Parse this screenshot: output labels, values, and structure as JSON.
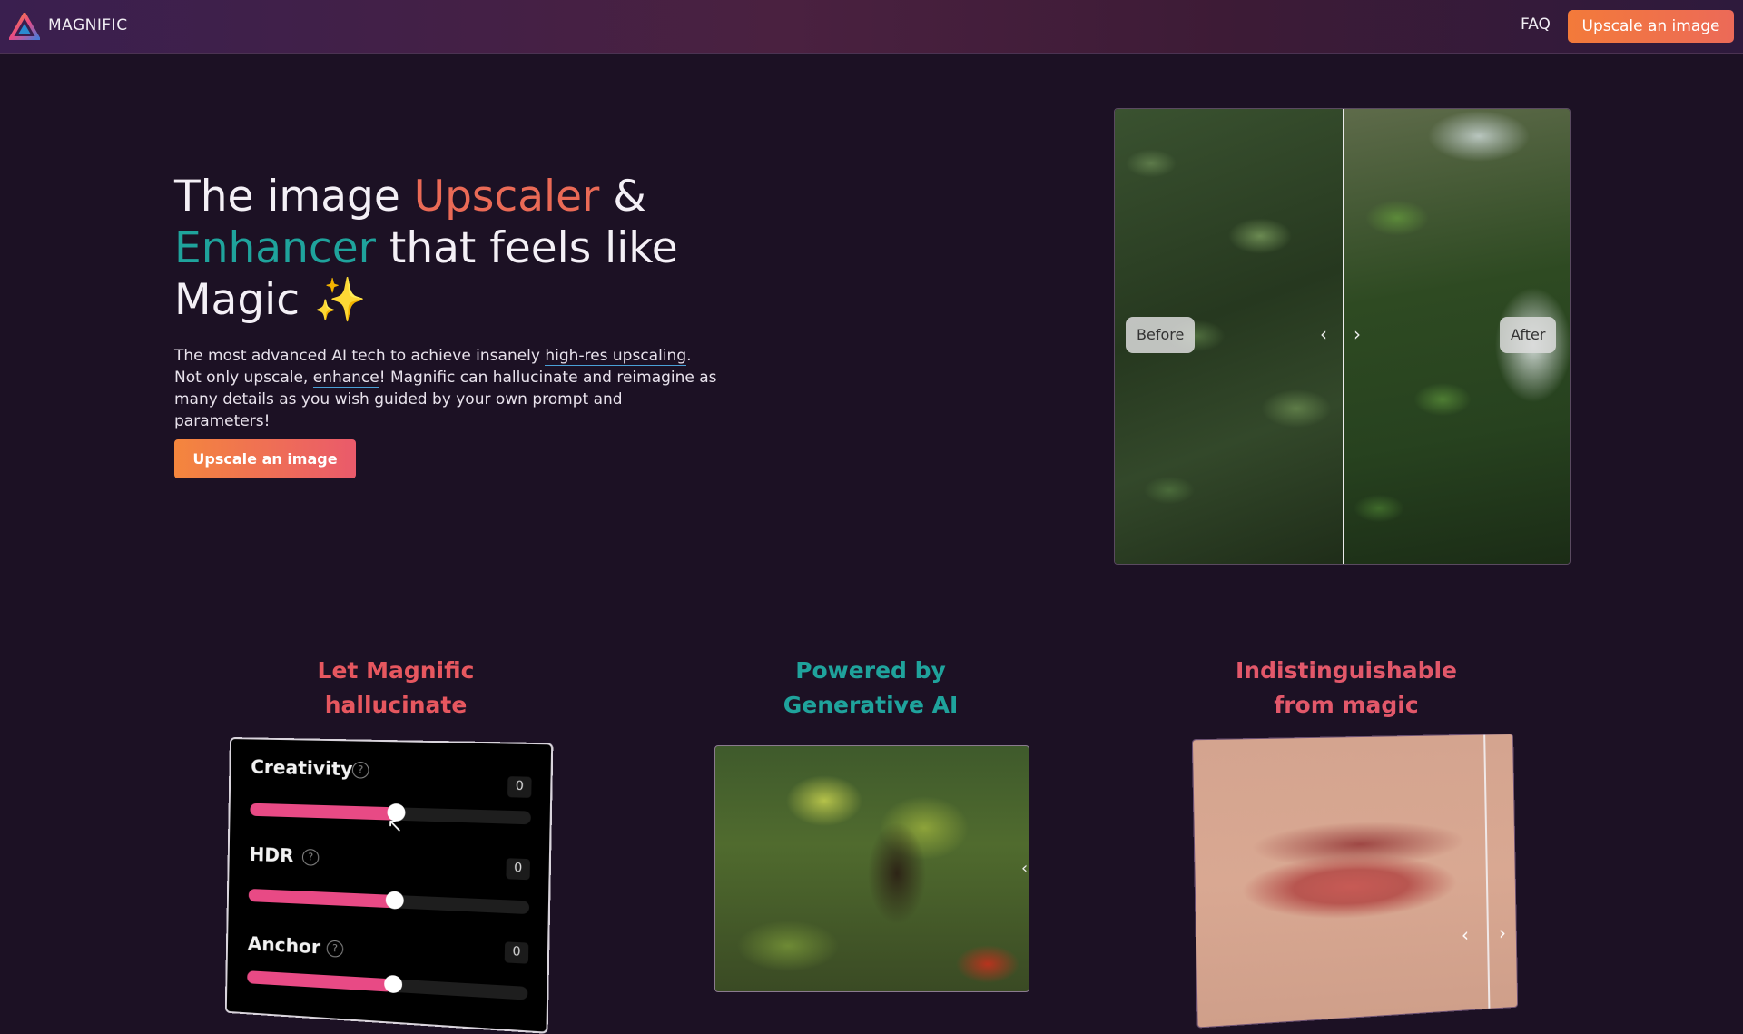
{
  "header": {
    "brand": "MAGNIFIC",
    "faq": "FAQ",
    "cta": "Upscale an image"
  },
  "hero": {
    "title_part1": "The image ",
    "title_upscaler": "Upscaler",
    "title_amp": " &",
    "title_enhancer": "Enhancer",
    "title_part2": " that feels like",
    "title_part3": "Magic ",
    "title_glyph": "✨",
    "desc_1": "The most advanced AI tech to achieve insanely ",
    "link_highres": "high-res upscaling",
    "desc_2": ". Not only upscale, ",
    "link_enhance": "enhance",
    "desc_3": "! Magnific can hallucinate and reimagine as many details as you wish guided by ",
    "link_prompt": "your own prompt",
    "desc_4": " and parameters!",
    "cta": "Upscale an image"
  },
  "compare": {
    "before_label": "Before",
    "after_label": "After",
    "prev_icon": "chevron-left-icon",
    "next_icon": "chevron-right-icon"
  },
  "features": [
    {
      "title_line1": "Let Magnific",
      "title_line2": "hallucinate"
    },
    {
      "title_line1": "Powered by",
      "title_line2": "Generative AI"
    },
    {
      "title_line1": "Indistinguishable",
      "title_line2": "from magic"
    }
  ],
  "sliders": [
    {
      "label": "Creativity",
      "value": "0",
      "level": 0.53
    },
    {
      "label": "HDR",
      "value": "0",
      "level": 0.53
    },
    {
      "label": "Anchor",
      "value": "0",
      "level": 0.53
    }
  ],
  "colors": {
    "accent_orange": "#ea6a56",
    "accent_teal": "#1fa39c",
    "slider_pink": "#e84a85",
    "background": "#1c1124"
  }
}
